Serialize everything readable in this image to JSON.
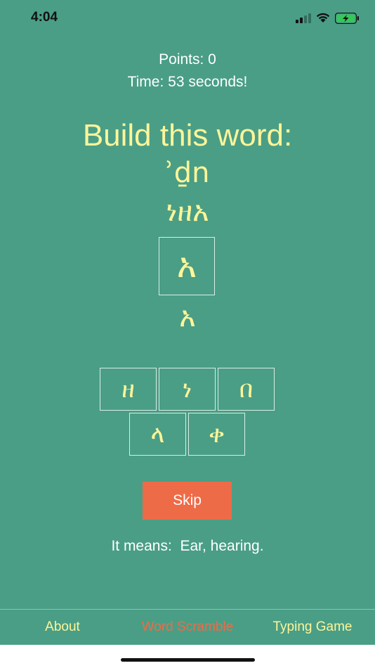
{
  "status_bar": {
    "time": "4:04",
    "icons": [
      "cellular-signal-icon",
      "wifi-icon",
      "battery-charging-icon"
    ],
    "battery_color": "#35c759"
  },
  "game": {
    "points_text": "Points: 0",
    "time_text": "Time: 53 seconds!",
    "heading": "Build this word:",
    "transliteration": "ʾḏn",
    "target_word": "ነዘአ",
    "current_slot_letter": "አ",
    "built_letter": "አ",
    "tiles": [
      "ዘ",
      "ነ",
      "በ",
      "ላ",
      "ቀ"
    ],
    "skip_label": "Skip",
    "meaning_text": "It means:  Ear, hearing."
  },
  "tabs": [
    {
      "label": "About",
      "active": false
    },
    {
      "label": "Word Scramble",
      "active": true
    },
    {
      "label": "Typing Game",
      "active": false
    }
  ],
  "colors": {
    "background": "#4a9e86",
    "accent_yellow": "#fdf59a",
    "accent_orange": "#ee6b47",
    "text_white": "#ffffff"
  }
}
